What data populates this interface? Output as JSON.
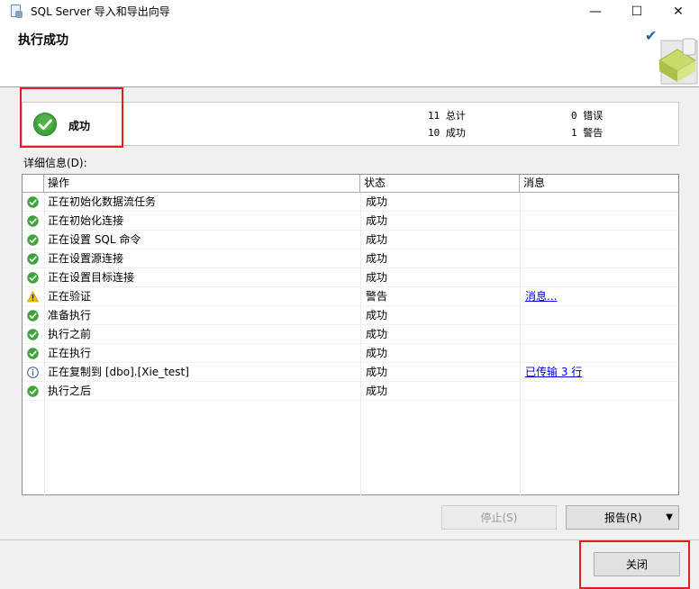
{
  "window": {
    "title": "SQL Server 导入和导出向导",
    "minimize_glyph": "—",
    "maximize_glyph": "☐",
    "close_glyph": "✕"
  },
  "header": {
    "title": "执行成功",
    "check_glyph": "✔"
  },
  "status": {
    "label": "成功",
    "total": "11 总计",
    "success": "10 成功",
    "errors": "0 错误",
    "warnings": "1 警告"
  },
  "details": {
    "label": "详细信息(D):",
    "columns": [
      "操作",
      "状态",
      "消息"
    ],
    "rows": [
      {
        "icon": "success-icon",
        "action": "正在初始化数据流任务",
        "status": "成功",
        "message": ""
      },
      {
        "icon": "success-icon",
        "action": "正在初始化连接",
        "status": "成功",
        "message": ""
      },
      {
        "icon": "success-icon",
        "action": "正在设置 SQL 命令",
        "status": "成功",
        "message": ""
      },
      {
        "icon": "success-icon",
        "action": "正在设置源连接",
        "status": "成功",
        "message": ""
      },
      {
        "icon": "success-icon",
        "action": "正在设置目标连接",
        "status": "成功",
        "message": ""
      },
      {
        "icon": "warning-icon",
        "action": "正在验证",
        "status": "警告",
        "message": "消息..."
      },
      {
        "icon": "success-icon",
        "action": "准备执行",
        "status": "成功",
        "message": ""
      },
      {
        "icon": "success-icon",
        "action": "执行之前",
        "status": "成功",
        "message": ""
      },
      {
        "icon": "success-icon",
        "action": "正在执行",
        "status": "成功",
        "message": ""
      },
      {
        "icon": "info-icon",
        "action": "正在复制到 [dbo].[Xie_test]",
        "status": "成功",
        "message": "已传输 3 行"
      },
      {
        "icon": "success-icon",
        "action": "执行之后",
        "status": "成功",
        "message": ""
      }
    ]
  },
  "buttons": {
    "stop": "停止(S)",
    "report": "报告(R)",
    "report_arrow": "▼",
    "close": "关闭"
  },
  "colors": {
    "success": "#3fa33a",
    "warning": "#f2c300",
    "info": "#2b5797",
    "highlight": "#e02020",
    "link": "#0000ee"
  }
}
